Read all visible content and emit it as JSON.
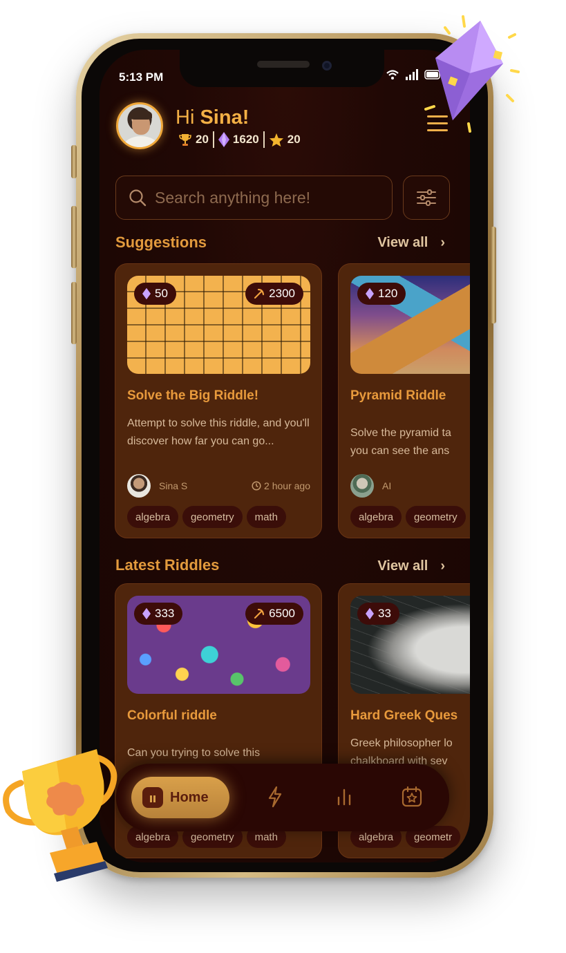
{
  "status_bar": {
    "time": "5:13 PM"
  },
  "header": {
    "greeting_prefix": "Hi ",
    "user_name": "Sina!",
    "trophies": "20",
    "gems": "1620",
    "stars": "20"
  },
  "search": {
    "placeholder": "Search anything here!"
  },
  "suggestions": {
    "title": "Suggestions",
    "view_all": "View all",
    "cards": [
      {
        "gems": "50",
        "score": "2300",
        "title": "Solve the Big Riddle!",
        "description": "Attempt to solve this riddle, and you'll discover how far you can go...",
        "author": "Sina S",
        "time": "2 hour ago",
        "tags": [
          "algebra",
          "geometry",
          "math"
        ]
      },
      {
        "gems": "120",
        "title": "Pyramid Riddle",
        "description": "Solve the pyramid ta you can see the ans",
        "author": "AI",
        "tags": [
          "algebra",
          "geometry"
        ]
      }
    ]
  },
  "latest": {
    "title": "Latest Riddles",
    "view_all": "View all",
    "cards": [
      {
        "gems": "333",
        "score": "6500",
        "title": "Colorful riddle",
        "description": "Can you trying to solve this",
        "tags": [
          "algebra",
          "geometry",
          "math"
        ]
      },
      {
        "gems": "33",
        "title": "Hard Greek Ques",
        "description": "Greek philosopher lo chalkboard with sev",
        "tags": [
          "algebra",
          "geometr"
        ]
      }
    ]
  },
  "bottom_nav": {
    "home_label": "Home",
    "items": [
      "home-icon",
      "lightning-icon",
      "chart-icon",
      "calendar-star-icon"
    ]
  },
  "colors": {
    "accent": "#e29a3d",
    "background": "#1f0704",
    "card": "#4f250c",
    "pill": "#3d0c09",
    "gem": "#b07cf0"
  }
}
